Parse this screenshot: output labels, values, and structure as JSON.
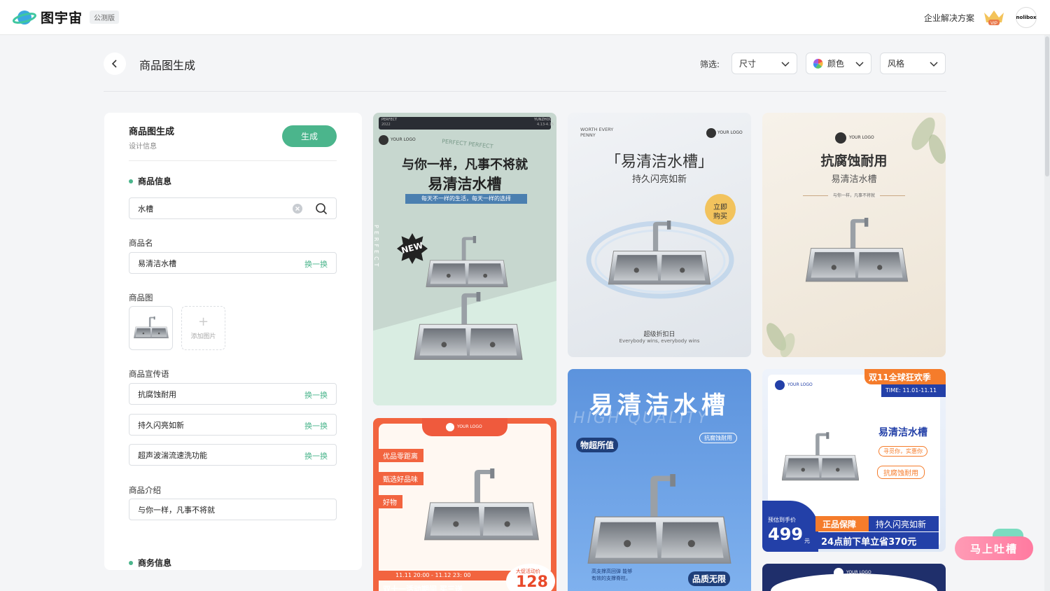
{
  "brand": {
    "name": "图宇宙",
    "badge": "公测版"
  },
  "nav": {
    "enterprise": "企业解决方案",
    "vip": "VIP",
    "avatar_text": "nolibox"
  },
  "page": {
    "title": "商品图生成"
  },
  "filters": {
    "label": "筛选:",
    "size": "尺寸",
    "color": "颜色",
    "style": "风格"
  },
  "form": {
    "title": "商品图生成",
    "subtitle": "设计信息",
    "generate": "生成",
    "product_info": "商品信息",
    "search_value": "水槽",
    "name_label": "商品名",
    "name_value": "易清洁水槽",
    "swap": "换一换",
    "image_label": "商品图",
    "add_image": "添加图片",
    "slogan_label": "商品宣传语",
    "slogans": [
      "抗腐蚀耐用",
      "持久闪亮如新",
      "超声波湍流速洗功能"
    ],
    "intro_label": "商品介绍",
    "intro_value": "与你一样，凡事不将就",
    "business_info": "商务信息"
  },
  "cards": {
    "c1": {
      "top_left": "PERFECT",
      "year": "2022",
      "top_right": "YUNZHOU",
      "date": "4.13-4.15",
      "logo": "YOUR LOGO",
      "arc": "PERFECT PERFECT",
      "headline1": "与你一样，凡事不将就",
      "headline2": "易清洁水槽",
      "ribbon": "每天不一样的生活，每天一样的选择",
      "badge": "NEW",
      "vertical": "PERFECT"
    },
    "c2": {
      "corner": "WORTH EVERY PENNY",
      "logo": "YOUR LOGO",
      "headline": "「易清洁水槽」",
      "sub": "持久闪亮如新",
      "sticker1": "立即",
      "sticker2": "购买",
      "foot1": "超级折扣日",
      "foot2": "Everybody wins, everybody wins"
    },
    "c3": {
      "logo": "YOUR LOGO",
      "headline": "抗腐蚀耐用",
      "sub": "易清洁水槽",
      "tag": "与你一样，凡事不将就"
    },
    "c4": {
      "logo": "YOUR LOGO",
      "tag1": "优品零距离",
      "tag2": "甄选好品味",
      "tag3": "好物",
      "time": "11.11 20:00 - 11.12 23: 00",
      "promo": "大促活动价",
      "price": "128",
      "bottom": "双十一活动期间 买三送"
    },
    "c5": {
      "headline": "易清洁水槽",
      "watermark": "HIGH QUALITY",
      "tag": "抗腐蚀耐用",
      "bubble": "物超所值",
      "desc": "高支撑高回弹 能够有效的支撑脊柱。",
      "badge": "品质无限"
    },
    "c6": {
      "logo": "YOUR LOGO",
      "banner": "双11全球狂欢季",
      "time": "TIME: 11.01-11.11",
      "name": "易清洁水槽",
      "tag1": "寻觅你，实惠你",
      "tag2": "抗腐蚀耐用",
      "price_label": "预估到手价",
      "price": "499",
      "unit": "元",
      "guarantee": "正品保障",
      "shine": "持久闪亮如新",
      "discount": "24点前下单立省370元"
    },
    "c7": {
      "logo": "YOUR LOGO"
    }
  },
  "feedback": "马上吐槽",
  "colors": {
    "accent": "#4bb58c",
    "feedback": "#ff7aa0"
  }
}
